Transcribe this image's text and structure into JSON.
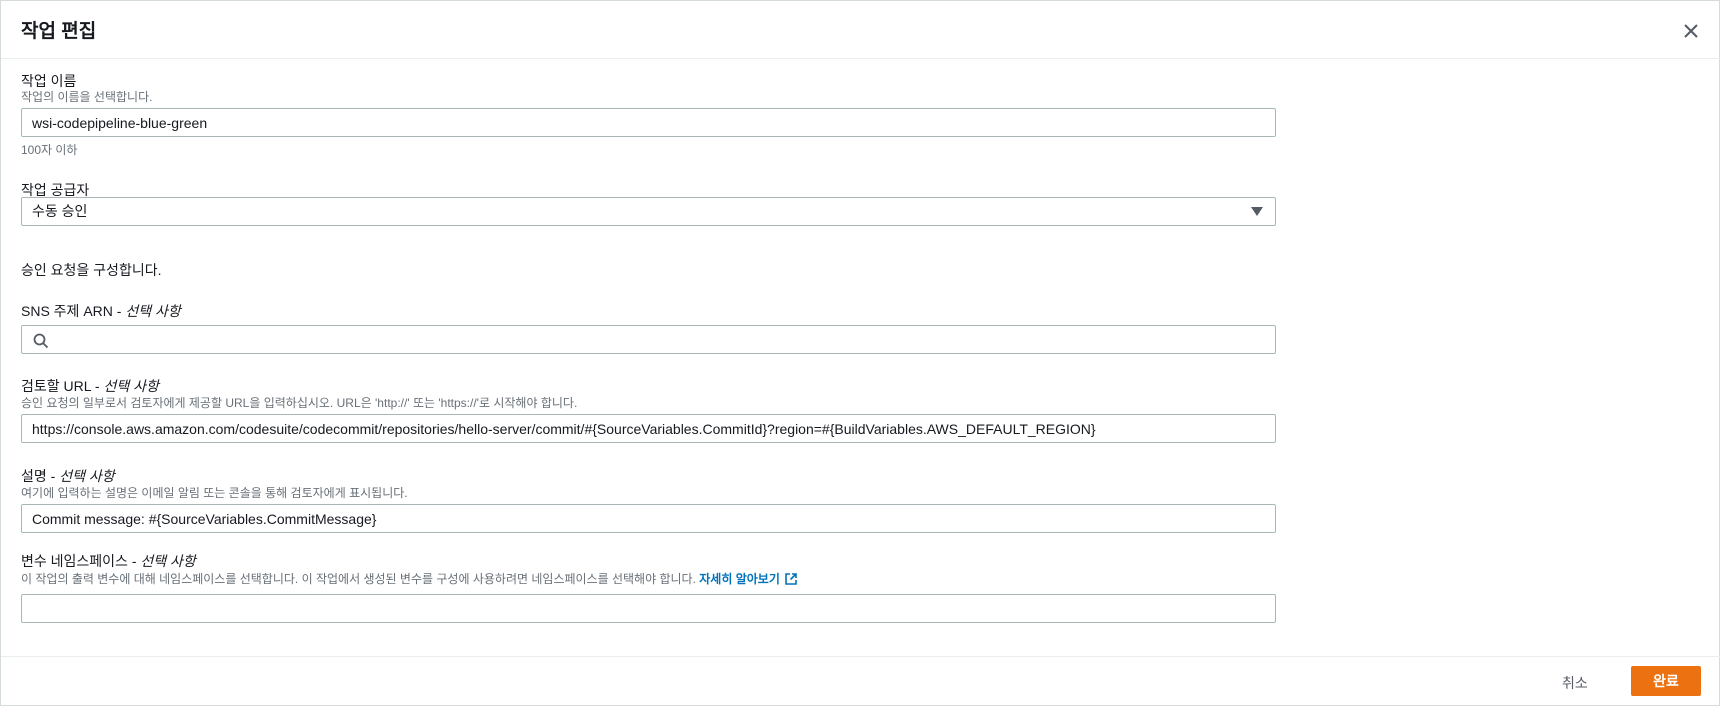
{
  "dialog": {
    "title": "작업 편집"
  },
  "action_name": {
    "label": "작업 이름",
    "description": "작업의 이름을 선택합니다.",
    "value": "wsi-codepipeline-blue-green",
    "hint": "100자 이하"
  },
  "action_provider": {
    "label": "작업 공급자",
    "selected": "수동 승인"
  },
  "approval_note": "승인 요청을 구성합니다.",
  "sns_arn": {
    "label": "SNS 주제 ARN - ",
    "optional": "선택 사항",
    "value": ""
  },
  "review_url": {
    "label": "검토할 URL - ",
    "optional": "선택 사항",
    "description": "승인 요청의 일부로서 검토자에게 제공할 URL을 입력하십시오. URL은 'http://' 또는 'https://'로 시작해야 합니다.",
    "value": "https://console.aws.amazon.com/codesuite/codecommit/repositories/hello-server/commit/#{SourceVariables.CommitId}?region=#{BuildVariables.AWS_DEFAULT_REGION}"
  },
  "comments": {
    "label": "설명 - ",
    "optional": "선택 사항",
    "description": "여기에 입력하는 설명은 이메일 알림 또는 콘솔을 통해 검토자에게 표시됩니다.",
    "value": "Commit message: #{SourceVariables.CommitMessage}"
  },
  "namespace": {
    "label": "변수 네임스페이스 - ",
    "optional": "선택 사항",
    "description": "이 작업의 출력 변수에 대해 네임스페이스를 선택합니다. 이 작업에서 생성된 변수를 구성에 사용하려면 네임스페이스를 선택해야 합니다. ",
    "link": "자세히 알아보기",
    "value": ""
  },
  "footer": {
    "cancel_label": "취소",
    "done_label": "완료"
  },
  "colors": {
    "primary_button": "#ec7211",
    "link": "#0073bb"
  },
  "icons": [
    "close-icon",
    "select-arrow-icon",
    "search-icon",
    "external-link-icon"
  ]
}
